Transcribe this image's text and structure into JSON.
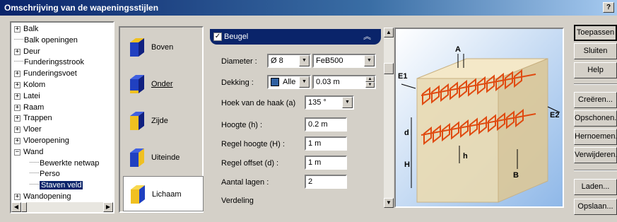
{
  "window": {
    "title": "Omschrijving van de wapeningsstijlen",
    "help_label": "?"
  },
  "tree": {
    "items": [
      {
        "label": "Balk",
        "expandable": true
      },
      {
        "label": "Balk openingen",
        "expandable": false
      },
      {
        "label": "Deur",
        "expandable": true
      },
      {
        "label": "Funderingsstrook",
        "expandable": false
      },
      {
        "label": "Funderingsvoet",
        "expandable": true
      },
      {
        "label": "Kolom",
        "expandable": true
      },
      {
        "label": "Latei",
        "expandable": true
      },
      {
        "label": "Raam",
        "expandable": true
      },
      {
        "label": "Trappen",
        "expandable": true
      },
      {
        "label": "Vloer",
        "expandable": true
      },
      {
        "label": "Vloeropening",
        "expandable": true
      },
      {
        "label": "Wand",
        "expandable": true,
        "expanded": true
      },
      {
        "label": "Bewerkte netwap",
        "child": true
      },
      {
        "label": "Perso",
        "child": true
      },
      {
        "label": "Staven veld",
        "child": true,
        "selected": true
      },
      {
        "label": "Wandopening",
        "expandable": true
      }
    ]
  },
  "categories": [
    {
      "label": "Boven",
      "active": false
    },
    {
      "label": "Onder",
      "active": false
    },
    {
      "label": "Zijde",
      "active": false
    },
    {
      "label": "Uiteinde",
      "active": false
    },
    {
      "label": "Lichaam",
      "active": true
    }
  ],
  "section": {
    "title": "Beugel",
    "checked": true
  },
  "properties": {
    "diameter_label": "Diameter :",
    "diameter_value": "Ø 8",
    "steel_value": "FeB500",
    "dekking_label": "Dekking :",
    "dekking_value": "Alle",
    "dekking_size": "0.03 m",
    "hook_label": "Hoek van de haak (a)",
    "hook_value": "135 °",
    "hoogte_label": "Hoogte (h) :",
    "hoogte_value": "0.2 m",
    "regel_hoogte_label": "Regel hoogte (H) :",
    "regel_hoogte_value": "1 m",
    "regel_offset_label": "Regel offset (d) :",
    "regel_offset_value": "1 m",
    "aantal_lagen_label": "Aantal lagen :",
    "aantal_lagen_value": "2",
    "verdeling_label": "Verdeling"
  },
  "figure_labels": {
    "a": "A",
    "b": "B",
    "d": "d",
    "h": "h",
    "H": "H",
    "e1": "E1",
    "e2": "E2"
  },
  "buttons": {
    "apply": "Toepassen",
    "close": "Sluiten",
    "help": "Help",
    "create": "Creëren...",
    "clean": "Opschonen...",
    "rename": "Hernoemen...",
    "delete": "Verwijderen...",
    "load": "Laden...",
    "save": "Opslaan..."
  },
  "colors": {
    "title_bar": "#0a246a",
    "selection": "#0a246a",
    "rebar": "#e04a10",
    "figure_bg": "#eadbb2"
  }
}
